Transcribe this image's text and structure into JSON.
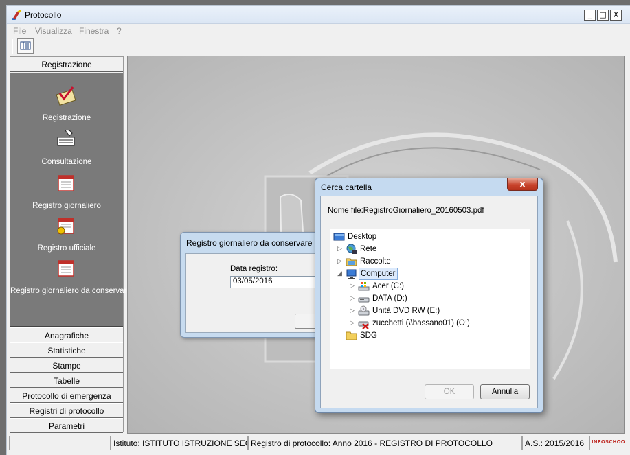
{
  "app": {
    "title": "Protocollo"
  },
  "window_controls": {
    "minimize": "_",
    "maximize": "□",
    "close": "X"
  },
  "menu": [
    "File",
    "Visualizza",
    "Finestra",
    "?"
  ],
  "sidebar": {
    "section": "Registrazione",
    "items": [
      {
        "label": "Registrazione",
        "icon": "register-envelope-icon"
      },
      {
        "label": "Consultazione",
        "icon": "consult-hands-icon"
      },
      {
        "label": "Registro giornaliero",
        "icon": "calendar-icon"
      },
      {
        "label": "Registro ufficiale",
        "icon": "calendar-warning-icon"
      },
      {
        "label": "Registro giornaliero da conservare",
        "icon": "calendar-icon"
      }
    ],
    "categories": [
      "Anagrafiche",
      "Statistiche",
      "Stampe",
      "Tabelle",
      "Protocollo di emergenza",
      "Registri di protocollo",
      "Parametri"
    ]
  },
  "status_bar": {
    "empty": "",
    "istituto": "Istituto: ISTITUTO ISTRUZIONE SECONDARIA",
    "registro": "Registro di protocollo: Anno 2016 - REGISTRO DI PROTOCOLLO",
    "anno_scolastico": "A.S.: 2015/2016",
    "logo": "INFOSCHOOL"
  },
  "back_dialog": {
    "title": "Registro giornaliero da conservare",
    "date_label": "Data registro:",
    "date_value": "03/05/2016"
  },
  "folder_dialog": {
    "title": "Cerca cartella",
    "close": "x",
    "filename": "Nome file:RegistroGiornaliero_20160503.pdf",
    "tree": [
      {
        "label": "Desktop",
        "icon": "desktop-icon",
        "expander": ""
      },
      {
        "label": "Rete",
        "icon": "network-icon",
        "expander": "▷"
      },
      {
        "label": "Raccolte",
        "icon": "libraries-icon",
        "expander": "▷"
      },
      {
        "label": "Computer",
        "icon": "computer-icon",
        "expander": "◢",
        "selected": true
      },
      {
        "label": "Acer (C:)",
        "icon": "system-drive-icon",
        "expander": "▷"
      },
      {
        "label": "DATA (D:)",
        "icon": "drive-icon",
        "expander": "▷"
      },
      {
        "label": "Unità DVD RW (E:)",
        "icon": "dvd-drive-icon",
        "expander": "▷"
      },
      {
        "label": "zucchetti (\\\\bassano01) (O:)",
        "icon": "network-drive-disconnected-icon",
        "expander": "▷"
      },
      {
        "label": "SDG",
        "icon": "folder-icon",
        "expander": ""
      }
    ],
    "ok": "OK",
    "cancel": "Annulla"
  },
  "colors": {
    "sidebar_panel": "#7a7a7a",
    "dialog_frame": "#c5daf0",
    "close_red": "#c8432b",
    "selection": "#dceafc"
  }
}
